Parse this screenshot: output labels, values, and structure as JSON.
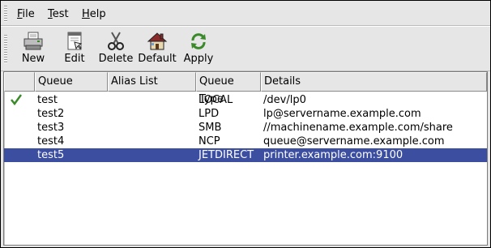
{
  "menubar": {
    "file": {
      "accel": "F",
      "rest": "ile"
    },
    "test": {
      "accel": "T",
      "rest": "est"
    },
    "help": {
      "accel": "H",
      "rest": "elp"
    }
  },
  "toolbar": {
    "new": {
      "label": "New",
      "icon": "printer-icon"
    },
    "edit": {
      "label": "Edit",
      "icon": "edit-printer-icon"
    },
    "delete": {
      "label": "Delete",
      "icon": "scissors-icon"
    },
    "default": {
      "label": "Default",
      "icon": "home-icon"
    },
    "apply": {
      "label": "Apply",
      "icon": "refresh-icon"
    }
  },
  "table": {
    "columns": [
      "",
      "Queue",
      "Alias List",
      "Queue Type",
      "Details"
    ],
    "rows": [
      {
        "default": true,
        "queue": "test",
        "alias": "",
        "type": "LOCAL",
        "details": "/dev/lp0",
        "selected": false
      },
      {
        "default": false,
        "queue": "test2",
        "alias": "",
        "type": "LPD",
        "details": "lp@servername.example.com",
        "selected": false
      },
      {
        "default": false,
        "queue": "test3",
        "alias": "",
        "type": "SMB",
        "details": "//machinename.example.com/share",
        "selected": false
      },
      {
        "default": false,
        "queue": "test4",
        "alias": "",
        "type": "NCP",
        "details": "queue@servername.example.com",
        "selected": false
      },
      {
        "default": false,
        "queue": "test5",
        "alias": "",
        "type": "JETDIRECT",
        "details": "printer.example.com:9100",
        "selected": true
      }
    ]
  },
  "colors": {
    "selection": "#3c4ea0",
    "check": "#3b8a2a"
  }
}
